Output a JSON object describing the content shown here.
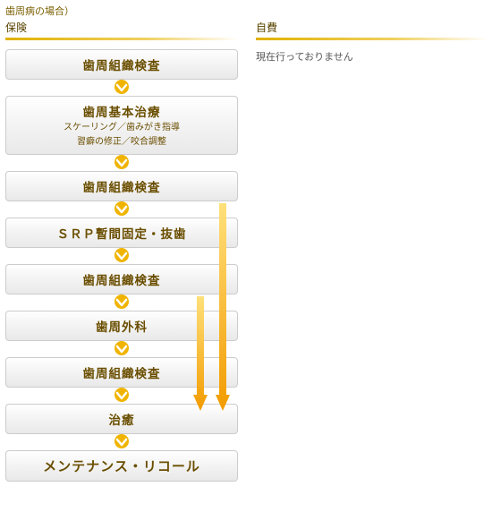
{
  "page_title": "歯周病の場合）",
  "left": {
    "heading": "保険",
    "steps": [
      {
        "title": "歯周組織検査",
        "sub": []
      },
      {
        "title": "歯周基本治療",
        "sub": [
          "スケーリング／歯みがき指導",
          "習癖の修正／咬合調整"
        ]
      },
      {
        "title": "歯周組織検査",
        "sub": []
      },
      {
        "title": "ＳＲＰ暫間固定・抜歯",
        "sub": []
      },
      {
        "title": "歯周組織検査",
        "sub": []
      },
      {
        "title": "歯周外科",
        "sub": []
      },
      {
        "title": "歯周組織検査",
        "sub": []
      },
      {
        "title": "治癒",
        "sub": []
      },
      {
        "title": "メンテナンス・リコール",
        "sub": []
      }
    ]
  },
  "right": {
    "heading": "自費",
    "note": "現在行っておりません"
  }
}
